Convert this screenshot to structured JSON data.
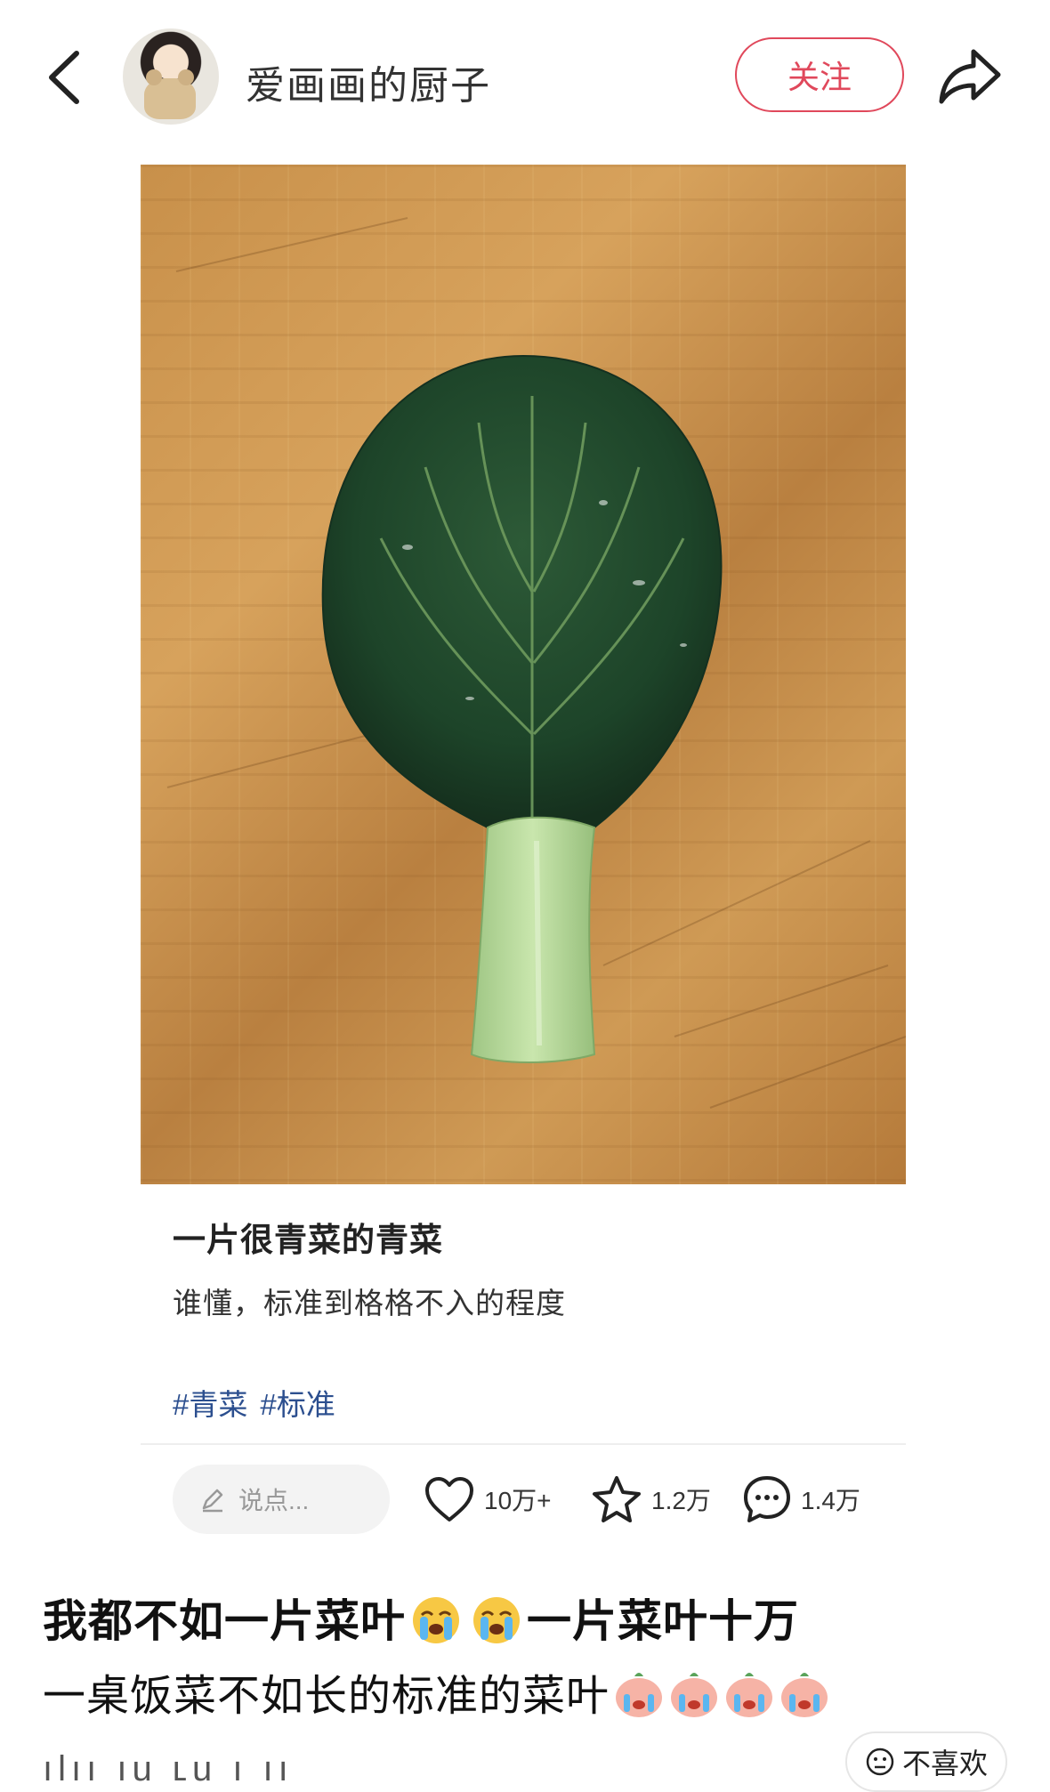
{
  "header": {
    "username": "爱画画的厨子",
    "follow_label": "关注"
  },
  "post": {
    "title": "一片很青菜的青菜",
    "description": "谁懂，标准到格格不入的程度",
    "tags": [
      "#青菜",
      "#标准"
    ]
  },
  "actions": {
    "comment_placeholder": "说点...",
    "likes": "10万+",
    "favorites": "1.2万",
    "comments": "1.4万"
  },
  "caption": {
    "line1_part1": "我都不如一片菜叶",
    "line1_part2": "一片菜叶十万",
    "line2": "一桌饭菜不如长的标准的菜叶"
  },
  "footer": {
    "watermark_fragment": "ılıı ıu ʟu ı ıı",
    "dislike_label": "不喜欢"
  },
  "colors": {
    "accent": "#e0485b",
    "tag": "#2c4f8f",
    "leaf": "#1f4a2c",
    "stem": "#b7d89a"
  }
}
